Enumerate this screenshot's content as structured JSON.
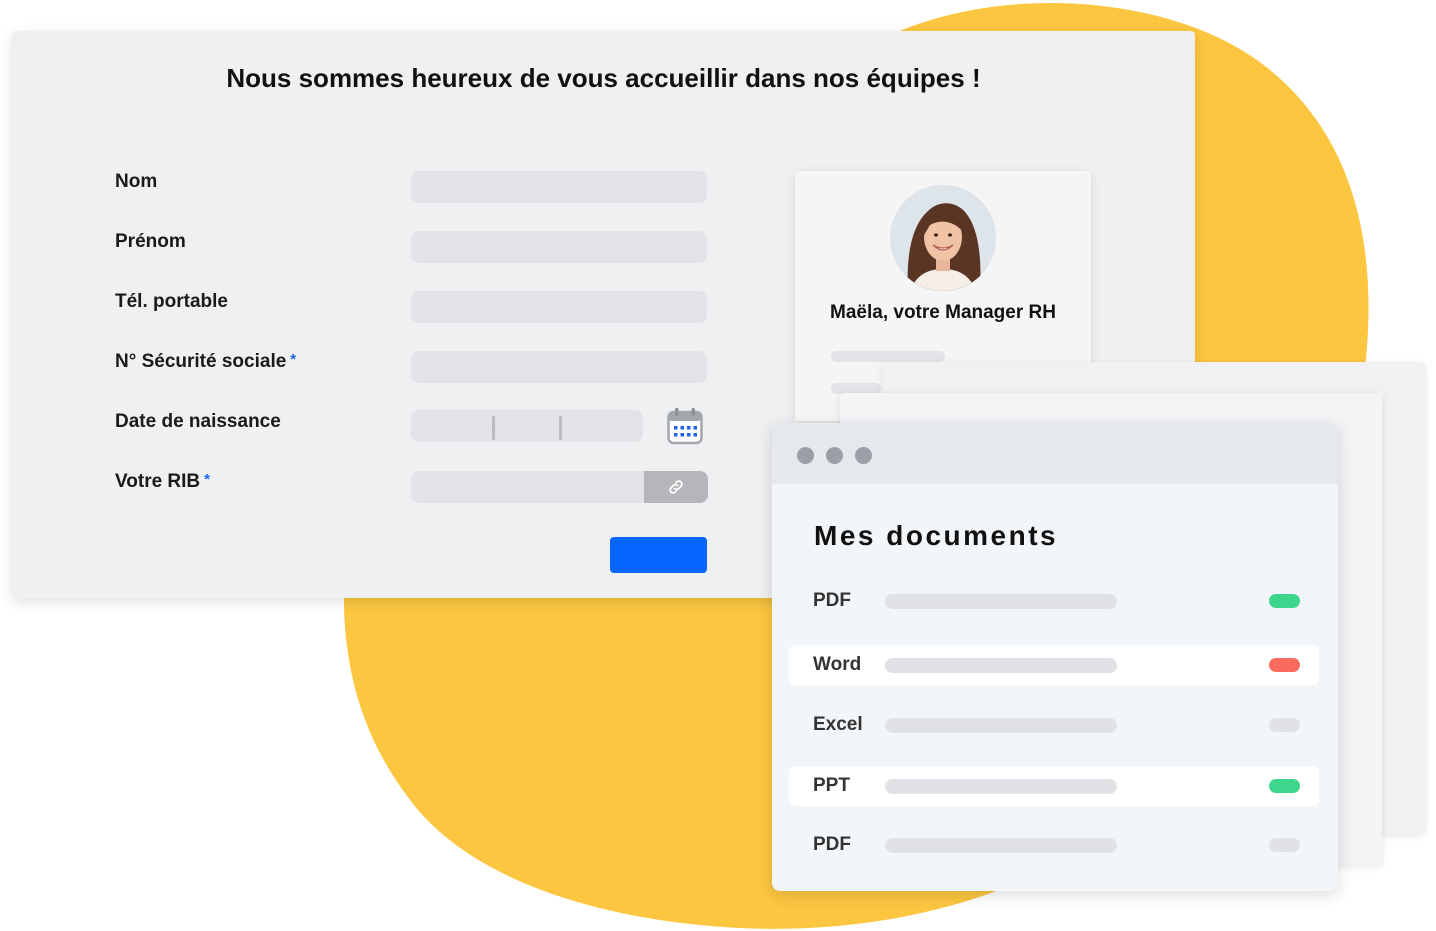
{
  "colors": {
    "blob": "#fcc640",
    "accent": "#0866ff",
    "required_star": "#1e63e9",
    "status_green": "#3dd68c",
    "status_red": "#fa6b5f",
    "status_grey": "#e1e2e5"
  },
  "form": {
    "title": "Nous sommes heureux de vous accueillir dans nos équipes !",
    "fields": [
      {
        "label": "Nom"
      },
      {
        "label": "Prénom"
      },
      {
        "label": "Tél. portable"
      },
      {
        "label": "N° Sécurité sociale",
        "required_mark": "*"
      },
      {
        "label": "Date de naissance"
      },
      {
        "label": "Votre RIB",
        "required_mark": "*"
      }
    ],
    "calendar_icon": "calendar-icon",
    "attach_icon": "link-icon"
  },
  "manager": {
    "name": "Maëla, votre Manager RH"
  },
  "documents": {
    "title": "Mes documents",
    "rows": [
      {
        "label": "PDF",
        "status": "green"
      },
      {
        "label": "Word",
        "status": "red"
      },
      {
        "label": "Excel",
        "status": "grey"
      },
      {
        "label": "PPT",
        "status": "green"
      },
      {
        "label": "PDF",
        "status": "grey"
      }
    ]
  }
}
